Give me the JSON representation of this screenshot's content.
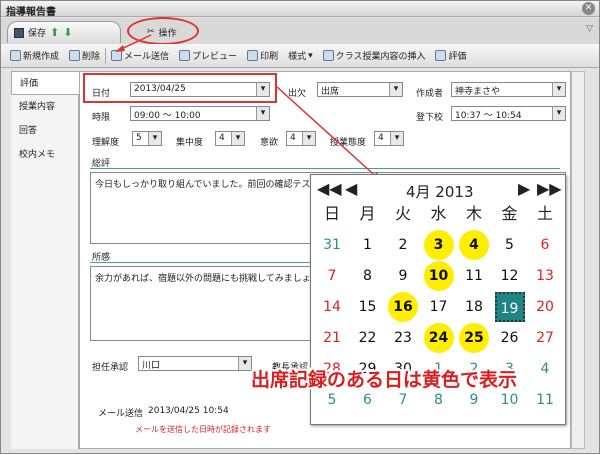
{
  "window": {
    "title": "指導報告書"
  },
  "ribbon": {
    "save": "保存",
    "ops": "操作"
  },
  "toolbar": {
    "new": "新規作成",
    "delete": "削除",
    "mail": "メール送信",
    "preview": "プレビュー",
    "print": "印刷",
    "format": "様式",
    "insert": "クラス授業内容の挿入",
    "eval": "評価"
  },
  "sidebar": {
    "items": [
      "評価",
      "授業内容",
      "回答",
      "校内メモ"
    ]
  },
  "form": {
    "date_label": "日付",
    "date_value": "2013/04/25",
    "attend_label": "出欠",
    "attend_value": "出席",
    "author_label": "作成者",
    "author_value": "神寺まさや",
    "period_label": "時限",
    "period_value": "09:00 ～ 10:00",
    "leave_label": "登下校",
    "leave_value": "10:37 ～ 10:54",
    "understand_label": "理解度",
    "understand_value": "5",
    "focus_label": "集中度",
    "focus_value": "4",
    "will_label": "意欲",
    "will_value": "4",
    "attitude_label": "授業態度",
    "attitude_value": "4",
    "summary_label": "総評",
    "summary_text": "今日もしっかり取り組んでいました。前回の確認テストも",
    "impression_label": "所感",
    "impression_text": "余力があれば、宿題以外の問題にも挑戦してみましょう。",
    "approve_label": "担任承認",
    "approve_value": "川口",
    "approve2_label": "教長承認",
    "mail_label": "メール送信",
    "mail_value": "2013/04/25 10:54",
    "mail_note": "メールを送信した日時が記録されます"
  },
  "calendar": {
    "month": "4月 2013",
    "nav_prev2": "◀◀",
    "nav_prev": "◀",
    "nav_next": "▶",
    "nav_next2": "▶▶",
    "dow": [
      "日",
      "月",
      "火",
      "水",
      "木",
      "金",
      "土"
    ],
    "weeks": [
      [
        "31",
        "1",
        "2",
        "3",
        "4",
        "5",
        "6"
      ],
      [
        "7",
        "8",
        "9",
        "10",
        "11",
        "12",
        "13"
      ],
      [
        "14",
        "15",
        "16",
        "17",
        "18",
        "19",
        "20"
      ],
      [
        "21",
        "22",
        "23",
        "24",
        "25",
        "26",
        "27"
      ],
      [
        "28",
        "29",
        "30",
        "1",
        "2",
        "3",
        "4"
      ],
      [
        "5",
        "6",
        "7",
        "8",
        "9",
        "10",
        "11"
      ]
    ],
    "highlighted": [
      "3",
      "4",
      "10",
      "16",
      "24",
      "25"
    ],
    "today": "19",
    "highlight_color": "#ffee00",
    "today_color": "#1e8484"
  },
  "annotation": {
    "banner": "出席記録のある日は黄色で表示"
  }
}
